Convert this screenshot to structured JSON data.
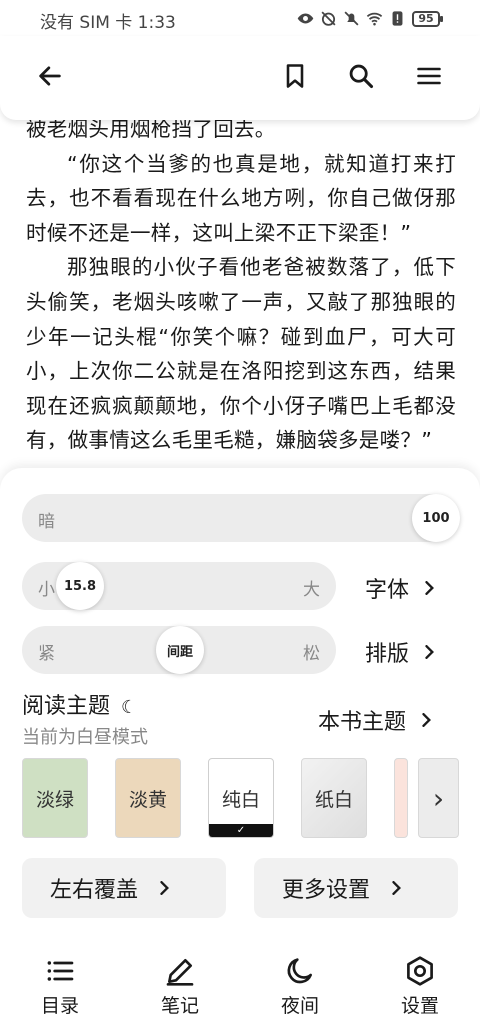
{
  "status_bar": {
    "carrier_time": "没有 SIM 卡 1:33",
    "battery": "95",
    "icons": [
      "eye-icon",
      "alarm-off-icon",
      "mute-icon",
      "wifi-icon",
      "alert-icon",
      "battery-icon"
    ]
  },
  "toolbar": {
    "icons": [
      "back-arrow-icon",
      "bookmark-icon",
      "search-icon",
      "menu-icon"
    ]
  },
  "reading": {
    "paragraphs": [
      "被老烟头用烟枪挡了回去。",
      "“你这个当爹的也真是地，就知道打来打去，也不看看现在什么地方咧，你自己做伢那时候不还是一样，这叫上梁不正下梁歪！”",
      "那独眼的小伙子看他老爸被数落了，低下头偷笑，老烟头咳嗽了一声，又敲了那独眼的少年一记头棍“你笑个嘛？碰到血尸，可大可小，上次你二公就是在洛阳挖到这东西，结果现在还疯疯颠颠地，你个小伢子嘴巴上毛都没有，做事情这么毛里毛糙，嫌脑袋多是喽？”"
    ]
  },
  "panel": {
    "brightness": {
      "label": "暗",
      "value": "100",
      "level_percent": 100
    },
    "font_size": {
      "min_label": "小",
      "max_label": "大",
      "value": "15.8",
      "link": "字体"
    },
    "spacing": {
      "min_label": "紧",
      "max_label": "松",
      "knob_label": "间距",
      "link": "排版"
    },
    "theme": {
      "title": "阅读主题",
      "moon_glyph": "☾",
      "subtitle": "当前为白昼模式",
      "book_theme_link": "本书主题",
      "swatches": [
        {
          "label": "淡绿",
          "color": "#cfe0c3"
        },
        {
          "label": "淡黄",
          "color": "#ecd8bb"
        },
        {
          "label": "纯白",
          "color": "#ffffff",
          "selected": true,
          "check": "✓"
        },
        {
          "label": "纸白",
          "color": "#e8e8e8"
        }
      ],
      "next_glyph": "›"
    },
    "buttons": {
      "cover": "左右覆盖",
      "more": "更多设置"
    }
  },
  "bottom_nav": [
    {
      "label": "目录",
      "icon": "list-icon"
    },
    {
      "label": "笔记",
      "icon": "pencil-icon"
    },
    {
      "label": "夜间",
      "icon": "moon-icon"
    },
    {
      "label": "设置",
      "icon": "settings-icon"
    }
  ],
  "colors": {
    "accent_dark": "#111111",
    "panel_track": "#ececec",
    "button_bg": "#f1f1f1"
  }
}
